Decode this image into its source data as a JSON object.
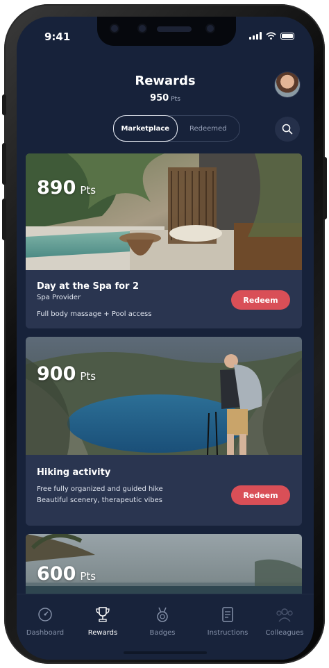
{
  "status": {
    "time": "9:41"
  },
  "header": {
    "title": "Rewards",
    "points": "950",
    "points_unit": "Pts"
  },
  "segments": {
    "marketplace": "Marketplace",
    "redeemed": "Redeemed",
    "active": "Marketplace"
  },
  "search": {
    "icon": "search-icon"
  },
  "cards": [
    {
      "points": "890",
      "unit": "Pts",
      "title": "Day at the Spa for 2",
      "provider": "Spa Provider",
      "description": "Full body massage + Pool access",
      "button": "Redeem"
    },
    {
      "points": "900",
      "unit": "Pts",
      "title": "Hiking activity",
      "line1": "Free fully organized and guided hike",
      "line2": "Beautiful scenery, therapeutic vibes",
      "button": "Redeem"
    },
    {
      "points": "600",
      "unit": "Pts"
    }
  ],
  "colors": {
    "background": "#17223a",
    "card": "#2a3550",
    "accent": "#d94f57"
  },
  "tabbar": {
    "items": [
      {
        "label": "Dashboard",
        "icon": "gauge-icon"
      },
      {
        "label": "Rewards",
        "icon": "trophy-icon",
        "active": true
      },
      {
        "label": "Badges",
        "icon": "medal-icon"
      },
      {
        "label": "Instructions",
        "icon": "instructions-icon"
      },
      {
        "label": "Colleagues",
        "icon": "people-icon"
      }
    ]
  }
}
